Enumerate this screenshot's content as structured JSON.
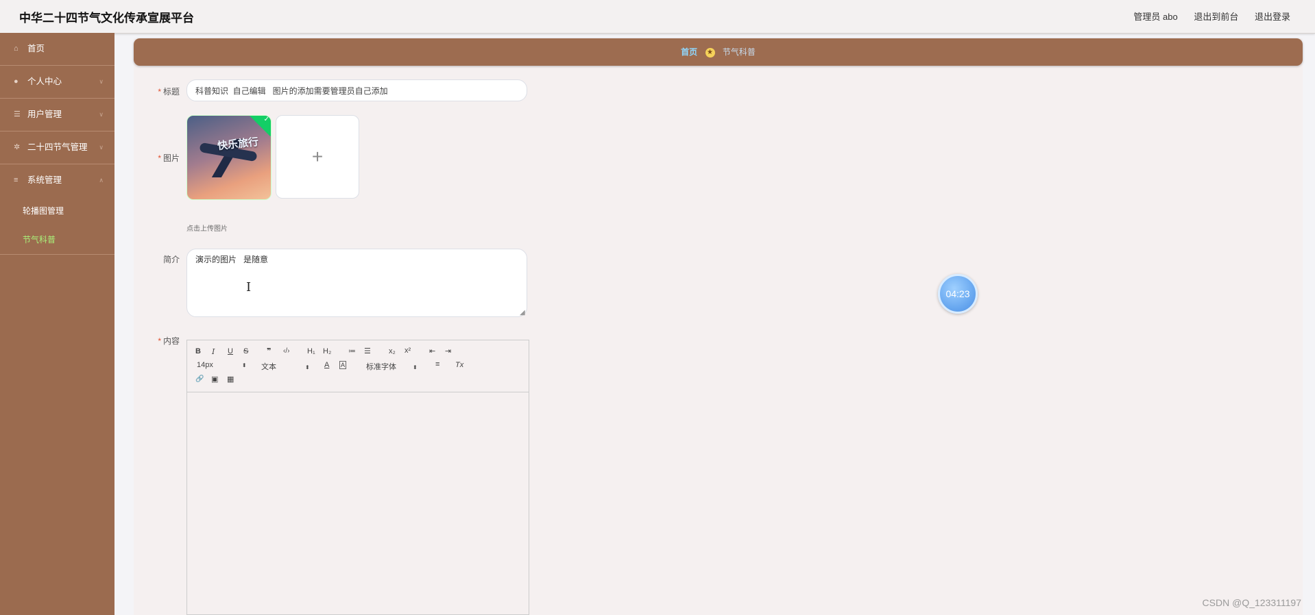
{
  "header": {
    "app_title": "中华二十四节气文化传承宣展平台",
    "admin_label": "管理员 abo",
    "back_to_front": "退出到前台",
    "logout": "退出登录"
  },
  "sidebar": {
    "items": [
      {
        "label": "首页",
        "icon": "home-icon"
      },
      {
        "label": "个人中心",
        "icon": "user-icon"
      },
      {
        "label": "用户管理",
        "icon": "sliders-icon"
      },
      {
        "label": "二十四节气管理",
        "icon": "cog-icon"
      },
      {
        "label": "系统管理",
        "icon": "menu-icon"
      }
    ],
    "sub_items": [
      {
        "label": "轮播图管理",
        "active": false
      },
      {
        "label": "节气科普",
        "active": true
      }
    ]
  },
  "breadcrumb": {
    "home": "首页",
    "current": "节气科普"
  },
  "form": {
    "title_label": "标题",
    "title_value": "科普知识  自己编辑   图片的添加需要管理员自己添加",
    "image_label": "图片",
    "thumb_text": "快乐旅行",
    "upload_tip": "点击上传图片",
    "intro_label": "简介",
    "intro_value": "演示的图片   是随意",
    "content_label": "内容"
  },
  "editor_toolbar": {
    "bold": "B",
    "italic": "I",
    "underline": "U",
    "strike": "S",
    "quote": "❞",
    "code": "‹/›",
    "h1": "H₁",
    "h2": "H₂",
    "ordered_list": "≔",
    "bullet_list": "☰",
    "subscript": "x₂",
    "superscript": "x²",
    "outdent": "⇤",
    "indent": "⇥",
    "font_size": "14px",
    "format": "文本",
    "font_color": "A",
    "bg_color": "A",
    "font_family": "标准字体",
    "align": "≡",
    "clear": "Tx",
    "link": "🔗",
    "image": "▣",
    "video": "▦"
  },
  "timer": "04:23",
  "watermark": "CSDN @Q_123311197",
  "colors": {
    "sidebar_bg": "#9b6b4f",
    "breadcrumb_bg": "#9d6c50",
    "active_menu": "#a9f07a",
    "required_star": "#e0502f"
  }
}
